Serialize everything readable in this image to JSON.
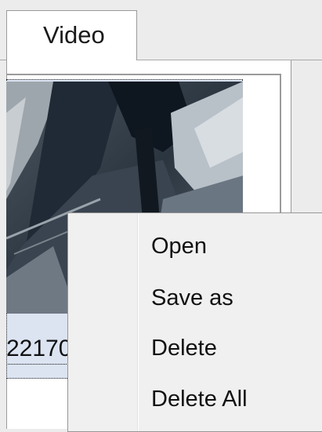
{
  "tabs": {
    "active_label": "Video"
  },
  "thumbnail": {
    "caption": "22170"
  },
  "context_menu": {
    "items": [
      "Open",
      "Save as",
      "Delete",
      "Delete All"
    ]
  }
}
